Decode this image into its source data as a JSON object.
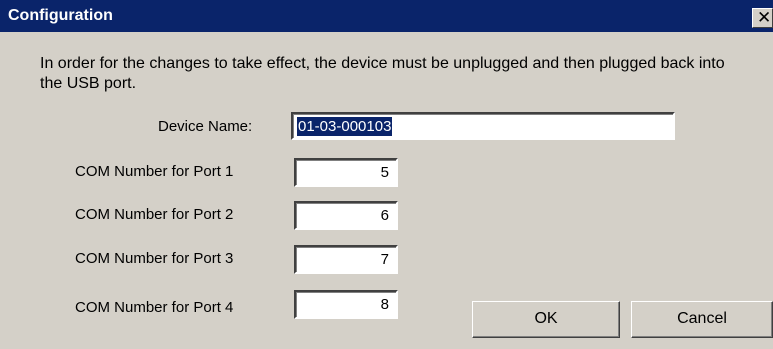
{
  "window": {
    "title": "Configuration",
    "close_glyph": "✕",
    "close_icon": "close-icon"
  },
  "message": "In order for the changes to take effect, the device must be unplugged and then plugged back into the USB port.",
  "device": {
    "label": "Device Name:",
    "value": "01-03-000103",
    "selected": true
  },
  "ports": [
    {
      "label": "COM Number for Port 1",
      "value": "5"
    },
    {
      "label": "COM Number for Port 2",
      "value": "6"
    },
    {
      "label": "COM Number for Port 3",
      "value": "7"
    },
    {
      "label": "COM Number for Port 4",
      "value": "8"
    }
  ],
  "buttons": {
    "ok": "OK",
    "cancel": "Cancel"
  },
  "colors": {
    "titlebar": "#0a246a",
    "dialog_face": "#d4d0c8",
    "selection": "#0a246a"
  }
}
